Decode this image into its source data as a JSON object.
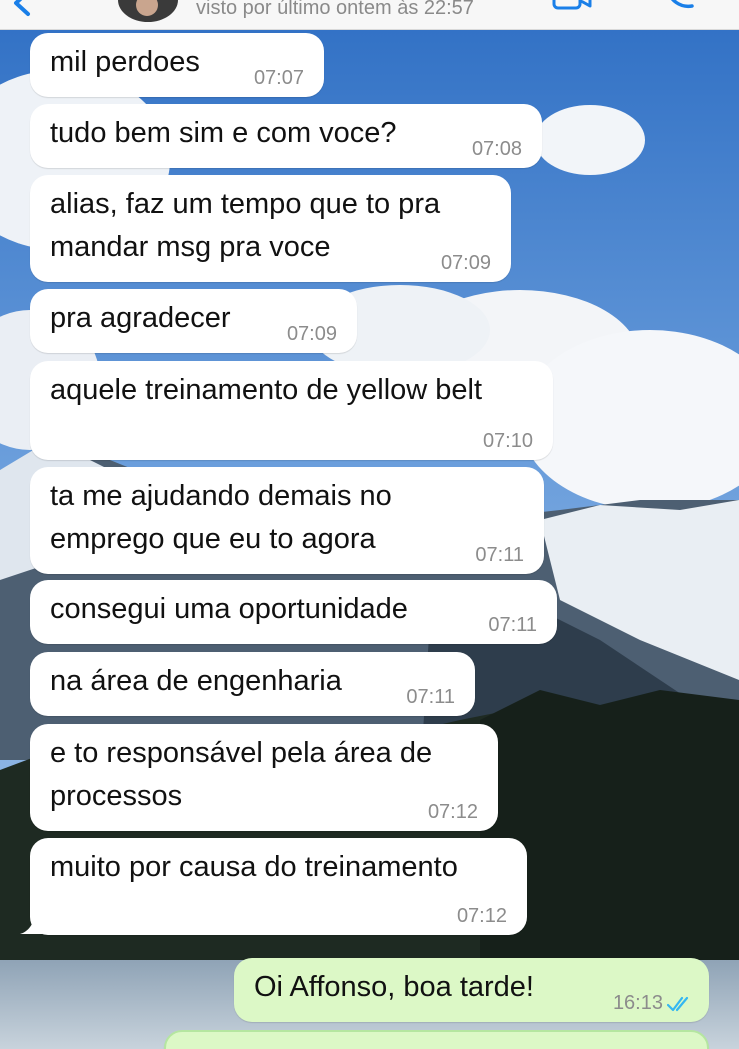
{
  "header": {
    "last_seen": "visto por último ontem às 22:57"
  },
  "messages": [
    {
      "text": "mil perdoes",
      "time": "07:07",
      "direction": "in"
    },
    {
      "text": "tudo bem sim e com voce?",
      "time": "07:08",
      "direction": "in"
    },
    {
      "text": "alias, faz um tempo que to pra mandar msg pra voce",
      "time": "07:09",
      "direction": "in"
    },
    {
      "text": "pra agradecer",
      "time": "07:09",
      "direction": "in"
    },
    {
      "text": "aquele treinamento de yellow belt",
      "time": "07:10",
      "direction": "in"
    },
    {
      "text": "ta me ajudando demais no emprego que eu to agora",
      "time": "07:11",
      "direction": "in"
    },
    {
      "text": "consegui uma oportunidade",
      "time": "07:11",
      "direction": "in"
    },
    {
      "text": "na área de engenharia",
      "time": "07:11",
      "direction": "in"
    },
    {
      "text": "e to responsável pela área de processos",
      "time": "07:12",
      "direction": "in"
    },
    {
      "text": "muito por causa do treinamento",
      "time": "07:12",
      "direction": "in"
    },
    {
      "text": "Oi Affonso, boa tarde!",
      "time": "16:13",
      "direction": "out",
      "status": "read"
    }
  ],
  "colors": {
    "incoming_bubble": "#ffffff",
    "outgoing_bubble": "#dcf8c6",
    "read_ticks": "#34b7f1",
    "timestamp": "#8c8c8c"
  }
}
